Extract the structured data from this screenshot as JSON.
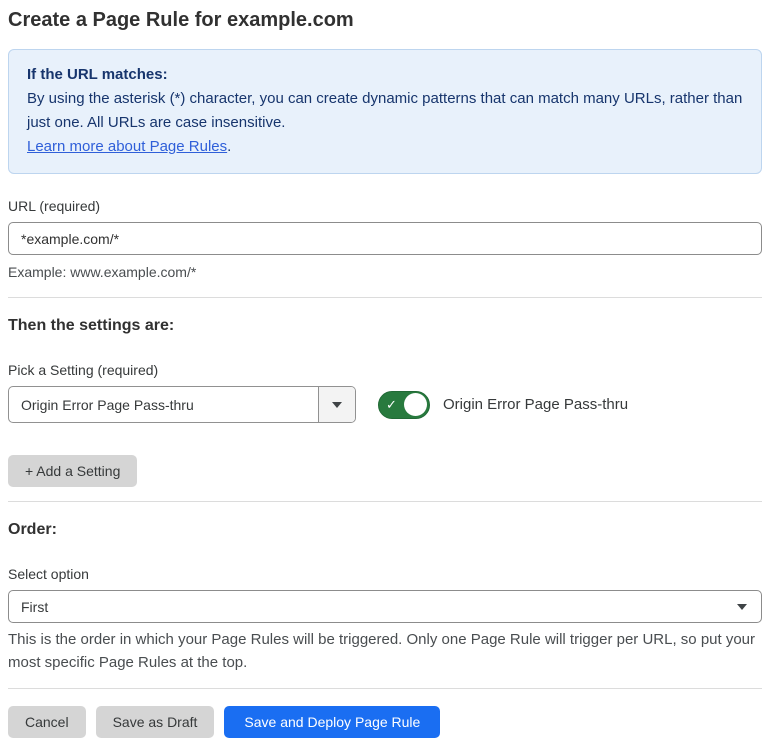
{
  "page": {
    "title": "Create a Page Rule for example.com"
  },
  "info_box": {
    "heading": "If the URL matches:",
    "body": "By using the asterisk (*) character, you can create dynamic patterns that can match many URLs, rather than just one. All URLs are case insensitive.",
    "link_label": "Learn more about Page Rules",
    "link_suffix": "."
  },
  "url_field": {
    "label": "URL (required)",
    "value": "*example.com/*",
    "helper": "Example: www.example.com/*"
  },
  "settings_section": {
    "heading": "Then the settings are:",
    "setting_label": "Pick a Setting (required)",
    "setting_value": "Origin Error Page Pass-thru",
    "toggle": {
      "state": "on",
      "check_icon": "✓",
      "label": "Origin Error Page Pass-thru"
    },
    "add_setting_label": "+ Add a Setting"
  },
  "order_section": {
    "heading": "Order:",
    "select_label": "Select option",
    "select_value": "First",
    "helper": "This is the order in which your Page Rules will be triggered. Only one Page Rule will trigger per URL, so put your most specific Page Rules at the top."
  },
  "footer": {
    "cancel_label": "Cancel",
    "save_draft_label": "Save as Draft",
    "save_deploy_label": "Save and Deploy Page Rule"
  },
  "colors": {
    "accent_blue": "#1a6ef2",
    "toggle_green": "#287a3e",
    "info_box_bg": "#e8f1fb",
    "info_box_border": "#bdd5ef",
    "info_text": "#17356d",
    "link_blue": "#2f5fd9",
    "button_gray": "#d5d5d5"
  },
  "icons": {
    "dropdown_arrow": "chevron-down",
    "toggle_check": "checkmark"
  }
}
